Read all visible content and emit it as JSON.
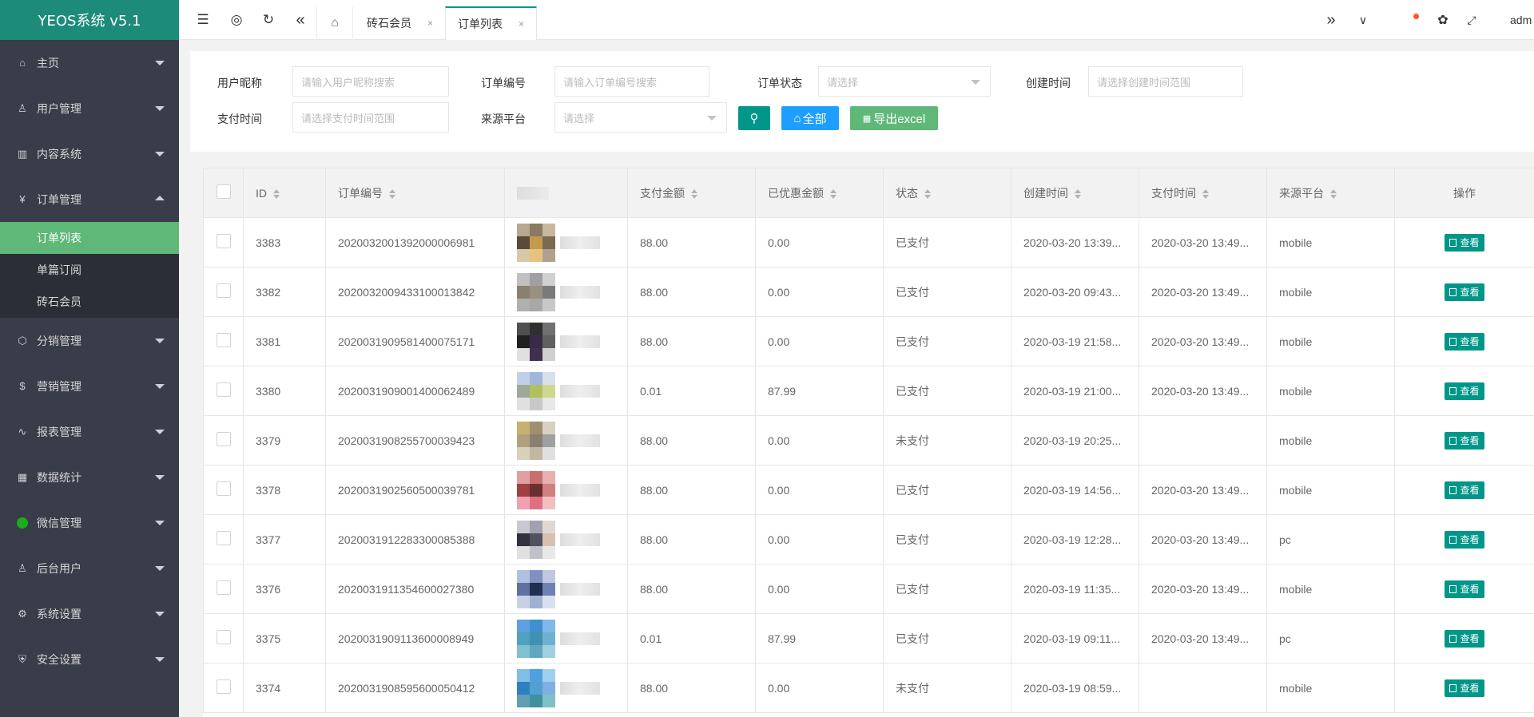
{
  "app": {
    "title": "YEOS系统 v5.1",
    "user": "adm"
  },
  "sidebar": {
    "items": [
      {
        "label": "主页",
        "icon": "home-icon"
      },
      {
        "label": "用户管理",
        "icon": "user-icon"
      },
      {
        "label": "内容系统",
        "icon": "content-icon"
      },
      {
        "label": "订单管理",
        "icon": "order-icon",
        "open": true,
        "children": [
          "订单列表",
          "单篇订阅",
          "砖石会员"
        ],
        "active_child": 0
      },
      {
        "label": "分销管理",
        "icon": "cube-icon"
      },
      {
        "label": "营销管理",
        "icon": "dollar-icon"
      },
      {
        "label": "报表管理",
        "icon": "pulse-icon"
      },
      {
        "label": "数据统计",
        "icon": "grid-icon"
      },
      {
        "label": "微信管理",
        "icon": "wechat-icon"
      },
      {
        "label": "后台用户",
        "icon": "user-icon"
      },
      {
        "label": "系统设置",
        "icon": "gear-icon"
      },
      {
        "label": "安全设置",
        "icon": "shield-icon"
      }
    ]
  },
  "tabs": [
    {
      "label": "砖石会员",
      "close": "×"
    },
    {
      "label": "订单列表",
      "close": "×"
    }
  ],
  "filter": {
    "nickname_label": "用户昵称",
    "nickname_placeholder": "请输入用户昵称搜索",
    "order_no_label": "订单编号",
    "order_no_placeholder": "请输入订单编号搜索",
    "status_label": "订单状态",
    "status_placeholder": "请选择",
    "created_label": "创建时间",
    "created_placeholder": "请选择创建时间范围",
    "paid_label": "支付时间",
    "paid_placeholder": "请选择支付时间范围",
    "platform_label": "来源平台",
    "platform_placeholder": "请选择",
    "all_button": "全部",
    "export_button": "导出excel"
  },
  "table": {
    "headers": [
      "ID",
      "订单编号",
      "",
      "支付金额",
      "已优惠金额",
      "状态",
      "创建时间",
      "支付时间",
      "来源平台",
      "操作"
    ],
    "view_label": "查看",
    "rows": [
      {
        "id": "3383",
        "order_no": "202003200139200000 6981",
        "amount": "88.00",
        "discount": "0.00",
        "status": "已支付",
        "created": "2020-03-20 13:39...",
        "paid": "2020-03-20 13:49...",
        "platform": "mobile",
        "avatar": [
          "#b8a890",
          "#8a7a60",
          "#c9b79d",
          "#5a4a3a",
          "#c49a4a",
          "#7a6a50",
          "#d8c8a8",
          "#e8c080",
          "#b0a090"
        ]
      },
      {
        "id": "3382",
        "order_no": "20200320094331000 13842",
        "amount": "88.00",
        "discount": "0.00",
        "status": "已支付",
        "created": "2020-03-20 09:43...",
        "paid": "2020-03-20 13:49...",
        "platform": "mobile",
        "avatar": [
          "#c0c0c0",
          "#a0a0a0",
          "#d0d0d0",
          "#8a8070",
          "#9a9080",
          "#7a7a7a",
          "#b0b0b0",
          "#a8a8a8",
          "#c8c8c8"
        ]
      },
      {
        "id": "3381",
        "order_no": "20200319095814000 75171",
        "amount": "88.00",
        "discount": "0.00",
        "status": "已支付",
        "created": "2020-03-19 21:58...",
        "paid": "2020-03-20 13:49...",
        "platform": "mobile",
        "avatar": [
          "#505050",
          "#303030",
          "#707070",
          "#202020",
          "#3a2a4a",
          "#606060",
          "#e0e0e0",
          "#403050",
          "#d0d0d0"
        ]
      },
      {
        "id": "3380",
        "order_no": "20200319090014000 62489",
        "amount": "0.01",
        "discount": "87.99",
        "status": "已支付",
        "created": "2020-03-19 21:00...",
        "paid": "2020-03-20 13:49...",
        "platform": "mobile",
        "avatar": [
          "#c0d0e8",
          "#a0b8d8",
          "#d8e0e8",
          "#a0a898",
          "#b0c060",
          "#d0d890",
          "#e0e0e0",
          "#c8c8c8",
          "#e8e8e8"
        ]
      },
      {
        "id": "3379",
        "order_no": "20200319082557000 39423",
        "amount": "88.00",
        "discount": "0.00",
        "status": "未支付",
        "created": "2020-03-19 20:25...",
        "paid": "",
        "platform": "mobile",
        "avatar": [
          "#c8b070",
          "#a09070",
          "#d8d0c0",
          "#b0a080",
          "#8a8070",
          "#a0a0a0",
          "#d8d0b8",
          "#c0b8a0",
          "#e0e0e0"
        ]
      },
      {
        "id": "3378",
        "order_no": "20200319025605000 39781",
        "amount": "88.00",
        "discount": "0.00",
        "status": "已支付",
        "created": "2020-03-19 14:56...",
        "paid": "2020-03-20 13:49...",
        "platform": "mobile",
        "avatar": [
          "#e0a0a0",
          "#c87070",
          "#e8b0b0",
          "#a04040",
          "#6a3030",
          "#d08080",
          "#f0a0b0",
          "#e07080",
          "#f0c0c0"
        ]
      },
      {
        "id": "3377",
        "order_no": "20200319122833000 85388",
        "amount": "88.00",
        "discount": "0.00",
        "status": "已支付",
        "created": "2020-03-19 12:28...",
        "paid": "2020-03-20 13:49...",
        "platform": "pc",
        "avatar": [
          "#c8c8d0",
          "#a0a0b0",
          "#e0d8d0",
          "#303040",
          "#505060",
          "#d8c0b0",
          "#e0e0e0",
          "#c0c0c8",
          "#e8e8e8"
        ]
      },
      {
        "id": "3376",
        "order_no": "20200319113546000 27380",
        "amount": "88.00",
        "discount": "0.00",
        "status": "已支付",
        "created": "2020-03-19 11:35...",
        "paid": "2020-03-20 13:49...",
        "platform": "mobile",
        "avatar": [
          "#b0c0e0",
          "#8090c0",
          "#c0c8e0",
          "#6070a0",
          "#203050",
          "#7080b0",
          "#c8d0e8",
          "#a0b0d0",
          "#d8e0f0"
        ]
      },
      {
        "id": "3375",
        "order_no": "20200319091136000 08949",
        "amount": "0.01",
        "discount": "87.99",
        "status": "已支付",
        "created": "2020-03-19 09:11...",
        "paid": "2020-03-20 13:49...",
        "platform": "pc",
        "avatar": [
          "#60a0e0",
          "#4090d0",
          "#80b8e8",
          "#50a0c0",
          "#4090b0",
          "#70b0d0",
          "#80c0d0",
          "#60a8c0",
          "#a0d0e0"
        ]
      },
      {
        "id": "3374",
        "order_no": "20200319085956000 50412",
        "amount": "88.00",
        "discount": "0.00",
        "status": "未支付",
        "created": "2020-03-19 08:59...",
        "paid": "",
        "platform": "mobile",
        "avatar": [
          "#80c0e8",
          "#50a0e0",
          "#a0d0f0",
          "#3080c0",
          "#50a0d0",
          "#80b0e0",
          "#60a0b0",
          "#4090a0",
          "#80c0c8"
        ]
      }
    ]
  },
  "colors": {
    "sidebar": "#393d49",
    "logo": "#1c8b7a",
    "active": "#5fb878",
    "teal": "#009688",
    "blue": "#1e9fff"
  }
}
